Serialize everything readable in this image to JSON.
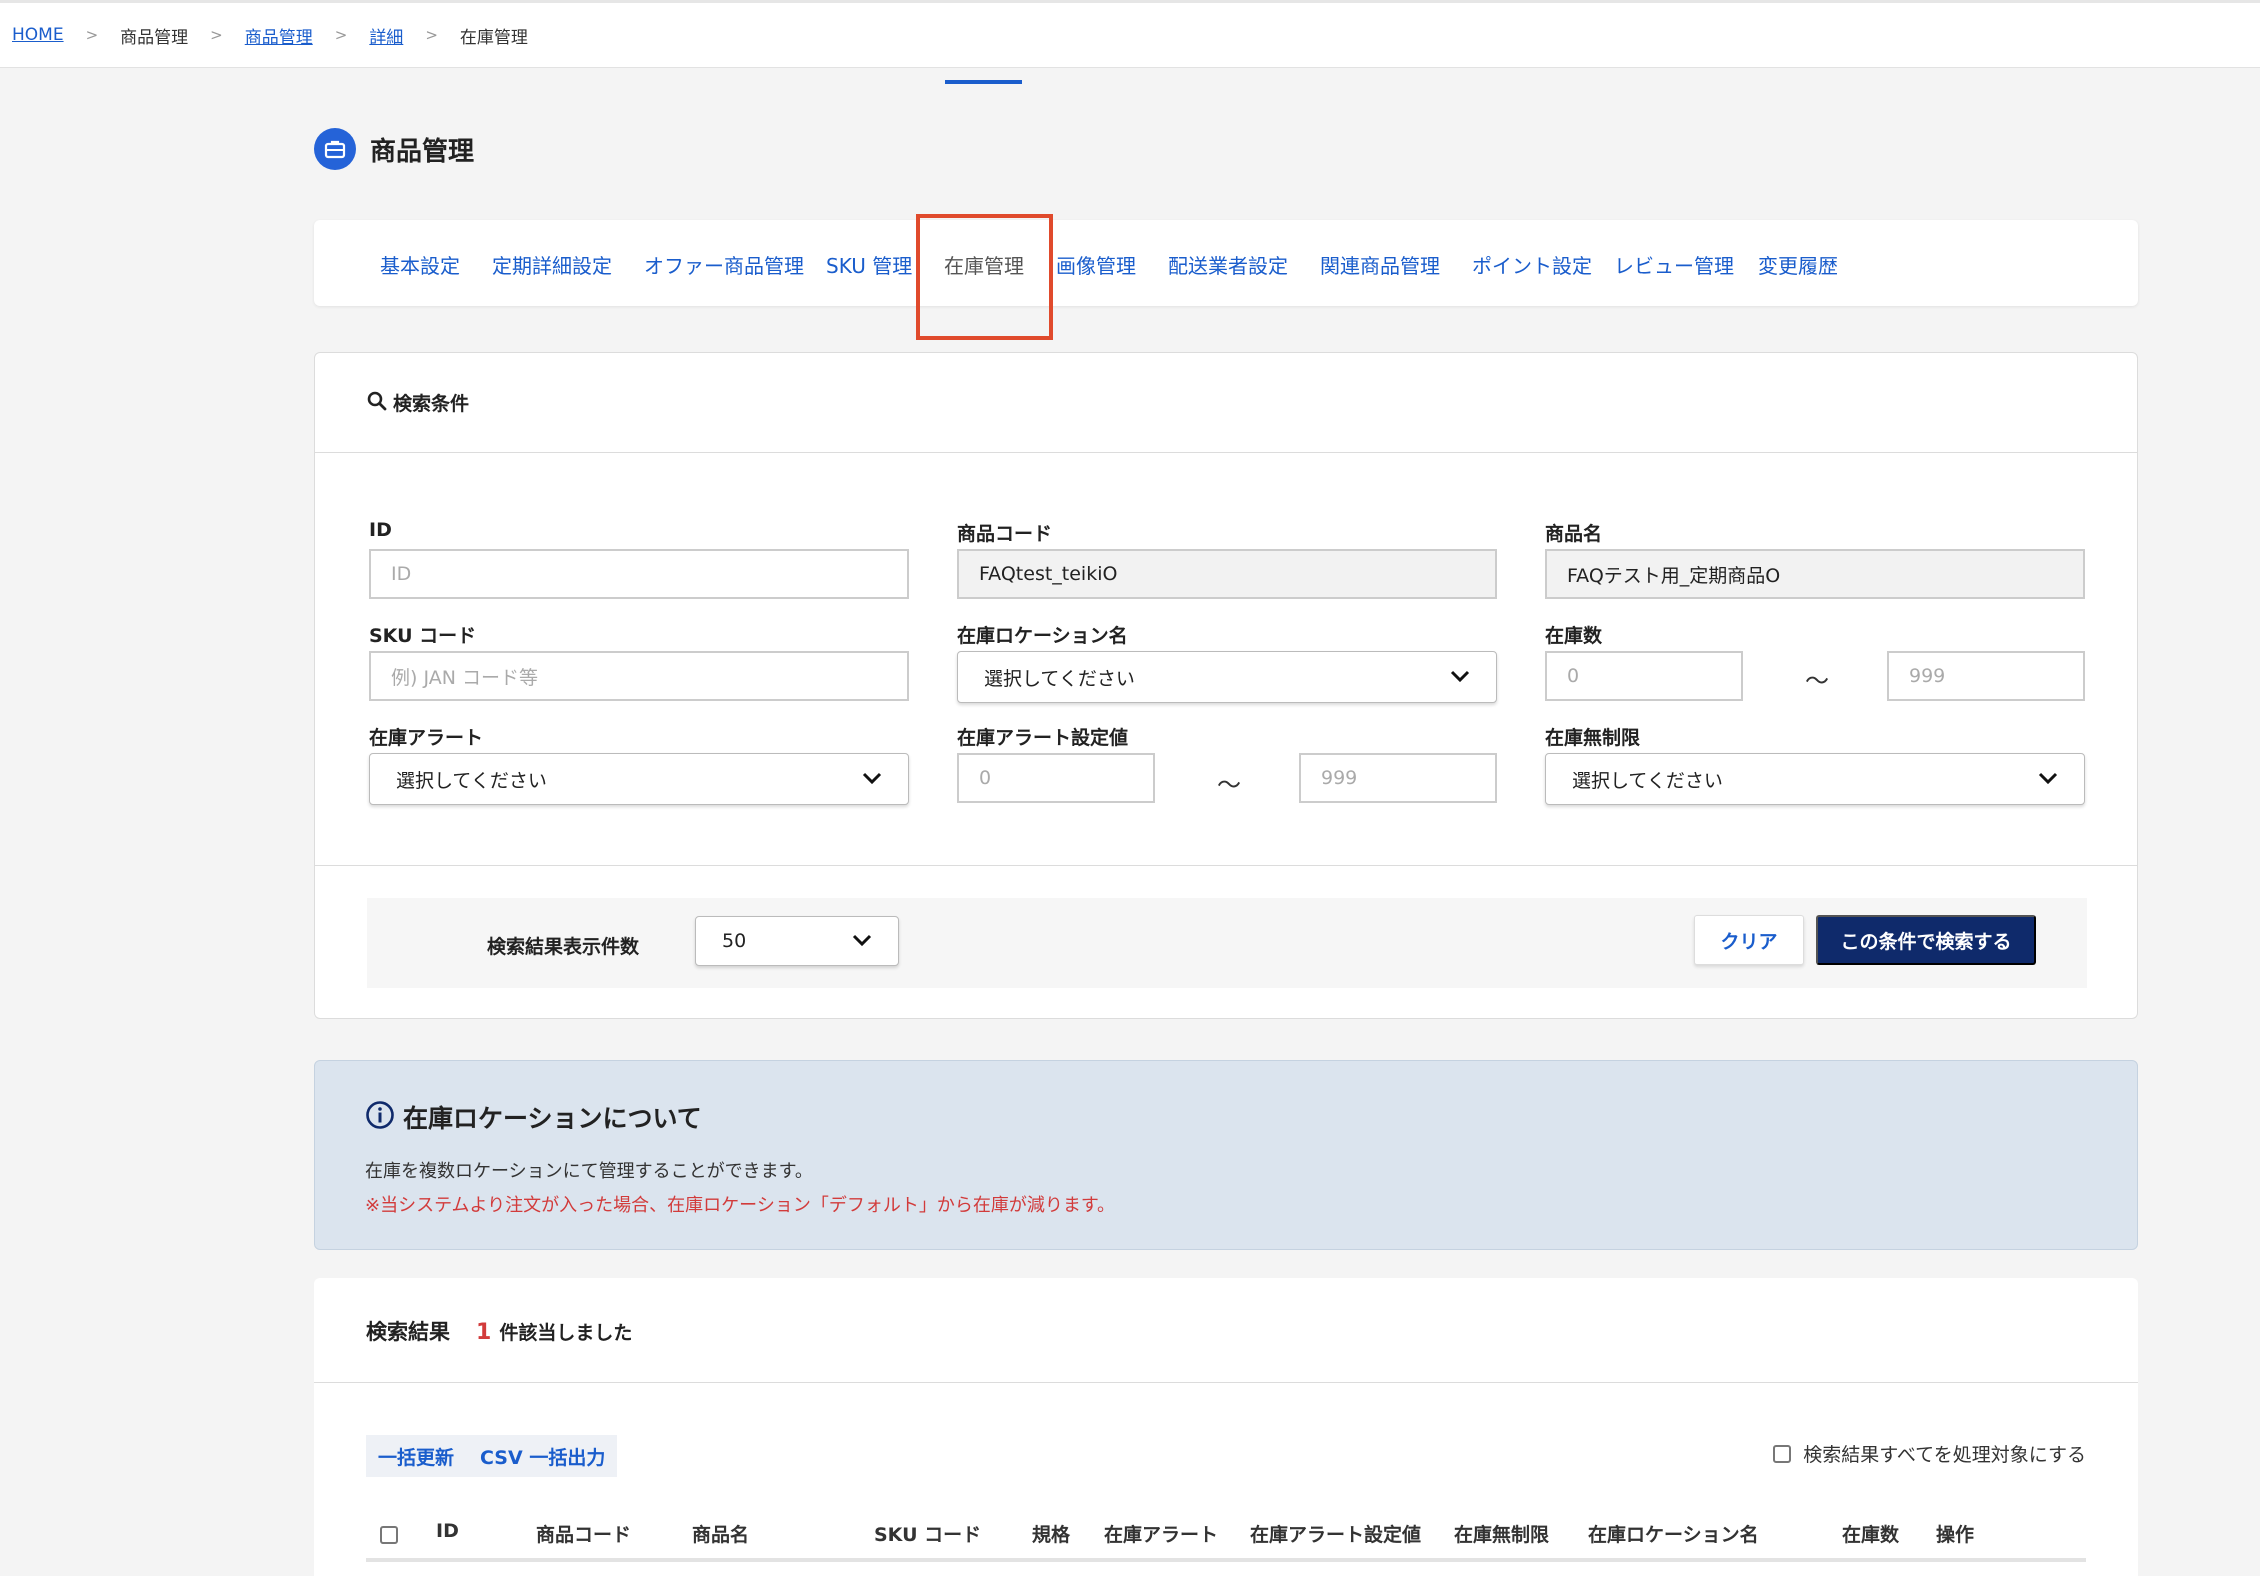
{
  "breadcrumb": {
    "home": "HOME",
    "item1": "商品管理",
    "item2": "商品管理",
    "item3": "詳細",
    "current": "在庫管理",
    "separator": ">"
  },
  "page": {
    "title": "商品管理"
  },
  "tabs": [
    {
      "label": "基本設定"
    },
    {
      "label": "定期詳細設定"
    },
    {
      "label": "オファー商品管理"
    },
    {
      "label": "SKU 管理"
    },
    {
      "label": "在庫管理"
    },
    {
      "label": "画像管理"
    },
    {
      "label": "配送業者設定"
    },
    {
      "label": "関連商品管理"
    },
    {
      "label": "ポイント設定"
    },
    {
      "label": "レビュー管理"
    },
    {
      "label": "変更履歴"
    }
  ],
  "search": {
    "heading": "検索条件",
    "id_label": "ID",
    "id_placeholder": "ID",
    "code_label": "商品コード",
    "code_value": "FAQtest_teikiO",
    "name_label": "商品名",
    "name_value": "FAQテスト用_定期商品O",
    "sku_label": "SKU コード",
    "sku_placeholder": "例) JAN コード等",
    "location_label": "在庫ロケーション名",
    "location_value": "選択してください",
    "stock_label": "在庫数",
    "stock_min_placeholder": "0",
    "stock_max_placeholder": "999",
    "alert_label": "在庫アラート",
    "alert_value": "選択してください",
    "alert_setting_label": "在庫アラート設定値",
    "alert_min_placeholder": "0",
    "alert_max_placeholder": "999",
    "unlimited_label": "在庫無制限",
    "unlimited_value": "選択してください",
    "tilde": "〜",
    "per_page_label": "検索結果表示件数",
    "per_page_value": "50",
    "clear_label": "クリア",
    "submit_label": "この条件で検索する"
  },
  "info": {
    "title": "在庫ロケーションについて",
    "text": "在庫を複数ロケーションにて管理することができます。",
    "warning": "※当システムより注文が入った場合、在庫ロケーション「デフォルト」から在庫が減ります。"
  },
  "results": {
    "heading": "検索結果",
    "count": "1",
    "suffix": "件該当しました",
    "bulk_update": "一括更新",
    "csv_export": "CSV 一括出力",
    "select_all": "検索結果すべてを処理対象にする",
    "columns": [
      "ID",
      "商品コード",
      "商品名",
      "SKU コード",
      "規格",
      "在庫アラート",
      "在庫アラート設定値",
      "在庫無制限",
      "在庫ロケーション名",
      "在庫数",
      "操作"
    ]
  },
  "colors": {
    "accent": "#1a5dcc",
    "primary_button": "#0f2a6b",
    "warning": "#d23b3b",
    "highlight": "#e04a2c"
  }
}
